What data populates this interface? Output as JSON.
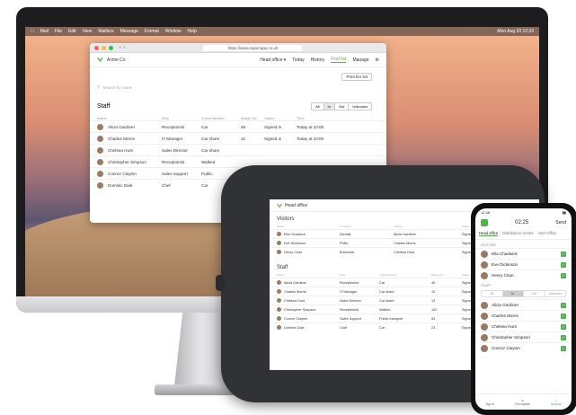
{
  "menubar": {
    "items": [
      "Mail",
      "File",
      "Edit",
      "View",
      "Mailbox",
      "Message",
      "Format",
      "Window",
      "Help"
    ],
    "right": [
      "✶",
      "Mon Aug 20 12:33"
    ]
  },
  "browser": {
    "url": "https://www.signinapp.co.uk",
    "app_name": "Acme Co",
    "location": "Head office",
    "nav": [
      "Today",
      "History",
      "Find list",
      "Manage"
    ],
    "active_nav": "Find list",
    "print_button": "Print fire list",
    "search_placeholder": "Search by name",
    "section_title": "Staff",
    "filters": [
      "All",
      "In",
      "Out",
      "Unknown"
    ],
    "columns": [
      "Name",
      "Role",
      "Travel Method",
      "Badge No",
      "Status",
      "Time"
    ],
    "rows": [
      {
        "name": "Alicia Gardiner",
        "role": "Receptionist",
        "travel": "Car",
        "badge": "45",
        "status": "Signed in",
        "time": "Today at 10:00"
      },
      {
        "name": "Charles Morris",
        "role": "IT Manager",
        "travel": "Car share",
        "badge": "12",
        "status": "Signed in",
        "time": "Today at 10:00"
      },
      {
        "name": "Chelsea Hunt",
        "role": "Sales Director",
        "travel": "Car share",
        "badge": "",
        "status": "",
        "time": ""
      },
      {
        "name": "Christopher Simpson",
        "role": "Receptionist",
        "travel": "Walked",
        "badge": "",
        "status": "",
        "time": ""
      },
      {
        "name": "Connor Clayton",
        "role": "Sales Support",
        "travel": "Public",
        "badge": "",
        "status": "",
        "time": ""
      },
      {
        "name": "Dominic Dale",
        "role": "Chef",
        "travel": "Car",
        "badge": "",
        "status": "",
        "time": ""
      }
    ]
  },
  "tablet": {
    "location": "Head office",
    "updated": "Last updated 20/11/2018",
    "visitors_title": "Visitors",
    "visitor_cols": [
      "Name",
      "Company",
      "Visiting",
      "Status",
      "Welcome"
    ],
    "visitors": [
      {
        "name": "Ella Chadwick",
        "company": "Zentalk",
        "visiting": "Alicia Gardiner",
        "status": "Signed in"
      },
      {
        "name": "Eve Dickinson",
        "company": "Phiflo",
        "visiting": "Charles Morris",
        "status": "Signed in"
      },
      {
        "name": "Henry Chan",
        "company": "Brainclick",
        "visiting": "Chelsea Hunt",
        "status": "Signed in"
      }
    ],
    "staff_title": "Staff",
    "staff_cols": [
      "Name",
      "Role",
      "Travel Method",
      "Badge No",
      "Status",
      "Sign time"
    ],
    "staff": [
      {
        "name": "Alicia Gardiner",
        "role": "Receptionist",
        "travel": "Car",
        "badge": "45",
        "status": "Signed in"
      },
      {
        "name": "Charles Morris",
        "role": "IT Manager",
        "travel": "Car share",
        "badge": "12",
        "status": "Signed in"
      },
      {
        "name": "Chelsea Hunt",
        "role": "Sales Director",
        "travel": "Car share",
        "badge": "13",
        "status": "Signed in"
      },
      {
        "name": "Christopher Simpson",
        "role": "Receptionist",
        "travel": "Walked",
        "badge": "102",
        "status": "Signed in"
      },
      {
        "name": "Connor Clayton",
        "role": "Sales Support",
        "travel": "Public transport",
        "badge": "54",
        "status": "Signed in"
      },
      {
        "name": "Dominic Dale",
        "role": "Chef",
        "travel": "Car",
        "badge": "23",
        "status": "Signed in"
      }
    ]
  },
  "phone": {
    "time": "12:48",
    "header_time": "02:25",
    "send": "Send",
    "tabs": [
      "Head office",
      "Distribution Centre",
      "USA Office"
    ],
    "visitors_label": "VISITORS",
    "visitors": [
      "Ella Chadwick",
      "Eve Dickinson",
      "Henry Chan"
    ],
    "staff_label": "STAFF",
    "staff_filters": [
      "All",
      "In",
      "Out",
      "Unknown"
    ],
    "staff": [
      "Alicia Gardiner",
      "Charles Morris",
      "Chelsea Hunt",
      "Christopher Simpson",
      "Connor Clayton"
    ],
    "bottom": [
      "Sign in",
      "Fire register",
      "Account"
    ]
  }
}
